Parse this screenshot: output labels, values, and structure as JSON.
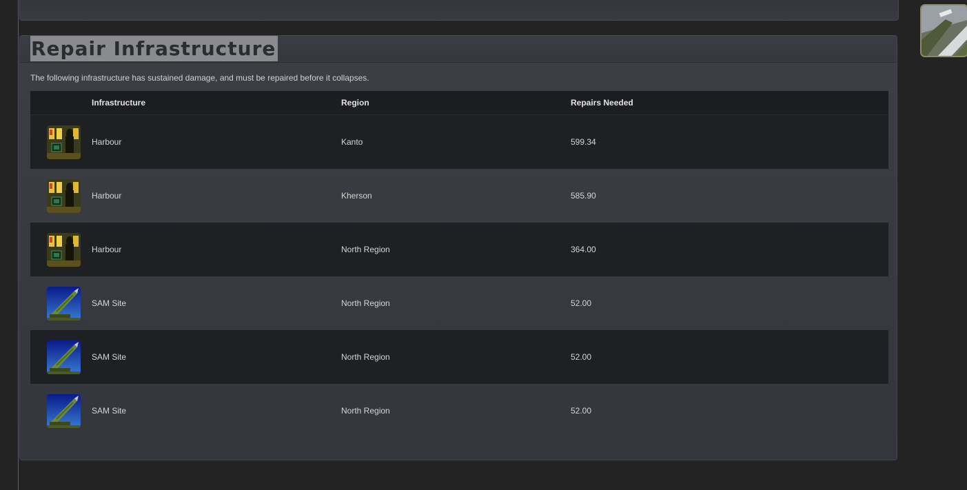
{
  "panel": {
    "title": "Repair Infrastructure",
    "intro": "The following infrastructure has sustained damage, and must be repaired before it collapses."
  },
  "table": {
    "headers": {
      "infrastructure": "Infrastructure",
      "region": "Region",
      "repairs": "Repairs Needed"
    },
    "rows": [
      {
        "name": "Harbour",
        "region": "Kanto",
        "repairs": "599.34",
        "icon": "harbour-icon"
      },
      {
        "name": "Harbour",
        "region": "Kherson",
        "repairs": "585.90",
        "icon": "harbour-icon"
      },
      {
        "name": "Harbour",
        "region": "North Region",
        "repairs": "364.00",
        "icon": "harbour-icon"
      },
      {
        "name": "SAM Site",
        "region": "North Region",
        "repairs": "52.00",
        "icon": "sam-site-icon"
      },
      {
        "name": "SAM Site",
        "region": "North Region",
        "repairs": "52.00",
        "icon": "sam-site-icon"
      },
      {
        "name": "SAM Site",
        "region": "North Region",
        "repairs": "52.00",
        "icon": "sam-site-icon"
      }
    ]
  },
  "colors": {
    "page_bg": "#232323",
    "panel_bg": "#3a3d43",
    "row_dark": "#1e2024",
    "title_highlight": "#8a8b8e"
  }
}
